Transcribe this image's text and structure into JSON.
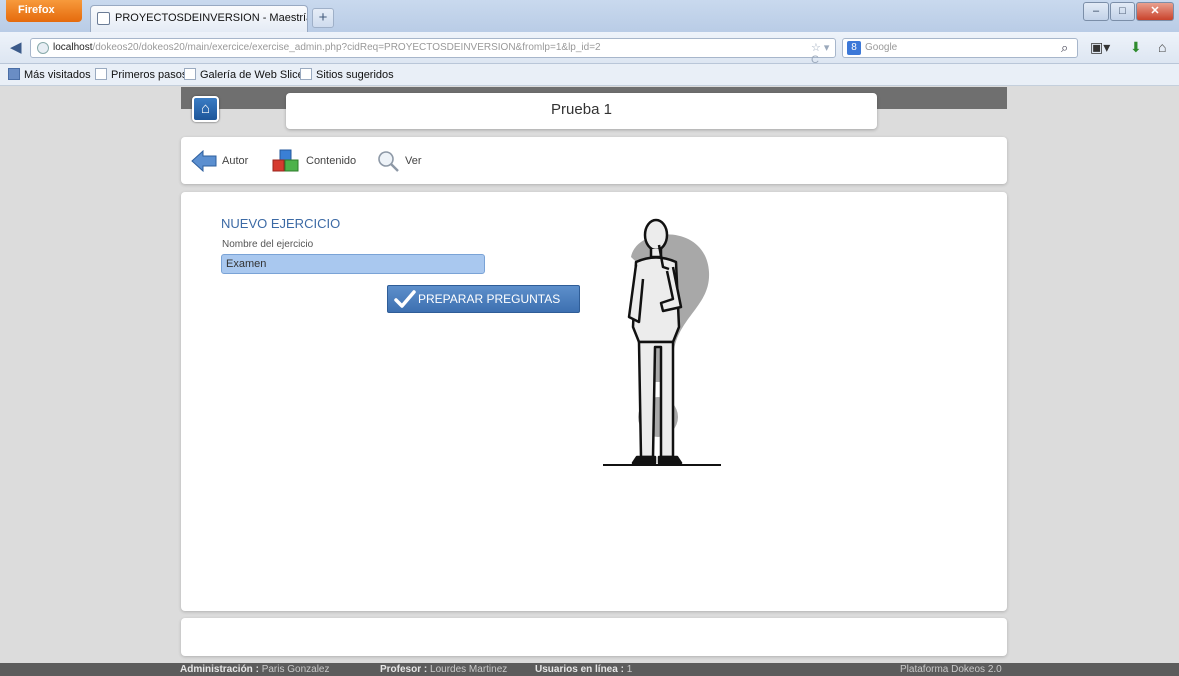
{
  "browser": {
    "menu_label": "Firefox",
    "tab_title": "PROYECTOSDEINVERSION - Maestría en ...",
    "new_tab_symbol": "+",
    "url_host": "localhost",
    "url_rest": "/dokeos20/dokeos20/main/exercice/exercise_admin.php?cidReq=PROYECTOSDEINVERSION&fromlp=1&lp_id=2",
    "search_placeholder": "Google",
    "window_buttons": [
      "minimize",
      "maximize",
      "close"
    ]
  },
  "bookmarks": [
    {
      "label": "Más visitados"
    },
    {
      "label": "Primeros pasos"
    },
    {
      "label": "Galería de Web Slice"
    },
    {
      "label": "Sitios sugeridos"
    }
  ],
  "header": {
    "title": "Prueba 1"
  },
  "toolbar": {
    "items": [
      {
        "label": "Autor",
        "icon": "back-arrow-icon"
      },
      {
        "label": "Contenido",
        "icon": "blocks-icon"
      },
      {
        "label": "Ver",
        "icon": "magnifier-icon"
      }
    ]
  },
  "exercise": {
    "heading": "NUEVO EJERCICIO",
    "field_label": "Nombre del ejercicio",
    "field_value": "Examen",
    "submit_label": "PREPARAR PREGUNTAS"
  },
  "footer": {
    "admin_label": "Administración :",
    "admin_name": "Paris Gonzalez",
    "teacher_label": "Profesor :",
    "teacher_name": "Lourdes Martinez",
    "online_label": "Usuarios en línea :",
    "online_count": "1",
    "platform": "Plataforma Dokeos 2.0"
  },
  "colors": {
    "accent_blue": "#3d70b1",
    "heading_blue": "#3c6aa5",
    "input_bg": "#a9c8ef",
    "footer_bg": "#5c5c5c"
  }
}
